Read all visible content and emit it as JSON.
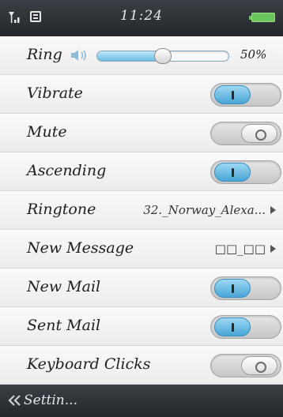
{
  "status_bar": {
    "time": "11:24",
    "signal_icon": "signal-icon",
    "message_icon": "message-icon",
    "battery_icon": "battery-icon",
    "battery_color": "#6cc55a"
  },
  "settings": {
    "ring": {
      "label": "Ring",
      "value": "50%",
      "level": 0.5,
      "icon": "speaker-icon"
    },
    "vibrate": {
      "label": "Vibrate",
      "on": true
    },
    "mute": {
      "label": "Mute",
      "on": false
    },
    "ascending": {
      "label": "Ascending",
      "on": true
    },
    "ringtone": {
      "label": "Ringtone",
      "value": "32._Norway_Alexa..."
    },
    "new_message": {
      "label": "New Message",
      "value": "□□_□□"
    },
    "new_mail": {
      "label": "New Mail",
      "on": true
    },
    "sent_mail": {
      "label": "Sent Mail",
      "on": true
    },
    "keyboard_clicks": {
      "label": "Keyboard Clicks",
      "on": false
    }
  },
  "bottom_bar": {
    "back_label": "Settin...",
    "back_icon": "double-chevron-left-icon"
  },
  "colors": {
    "toggle_on": "#49a5d6",
    "header_bg": "#2e3238"
  }
}
